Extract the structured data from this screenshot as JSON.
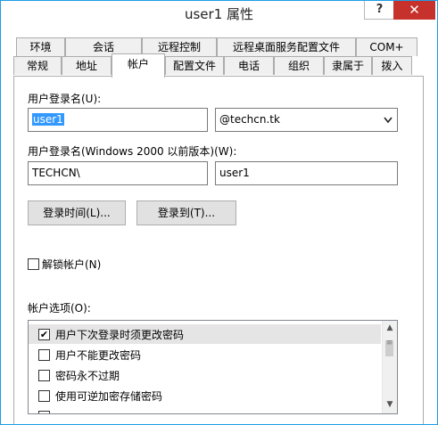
{
  "window": {
    "title": "user1 属性",
    "help_glyph": "?",
    "close_glyph": "✕"
  },
  "tabs_row1": [
    "环境",
    "会话",
    "远程控制",
    "远程桌面服务配置文件",
    "COM+"
  ],
  "tabs_row2": [
    "常规",
    "地址",
    "帐户",
    "配置文件",
    "电话",
    "组织",
    "隶属于",
    "拨入"
  ],
  "active_tab": "帐户",
  "account": {
    "logon_name_label": "用户登录名(U):",
    "logon_name_value": "user1",
    "domain_suffix": "@techcn.tk",
    "pre2000_label": "用户登录名(Windows 2000 以前版本)(W):",
    "pre2000_domain": "TECHCN\\",
    "pre2000_user": "user1",
    "logon_hours_button": "登录时间(L)...",
    "logon_to_button": "登录到(T)...",
    "unlock_label": "解锁帐户(N)",
    "unlock_checked": false,
    "options_label": "帐户选项(O):",
    "options": [
      {
        "label": "用户下次登录时须更改密码",
        "checked": true
      },
      {
        "label": "用户不能更改密码",
        "checked": false
      },
      {
        "label": "密码永不过期",
        "checked": false
      },
      {
        "label": "使用可逆加密存储密码",
        "checked": false
      },
      {
        "label": "",
        "checked": false
      }
    ]
  },
  "icons": {
    "dropdown": "chevron-down-icon",
    "check": "✔",
    "scroll_up": "▲",
    "scroll_down": "▼"
  }
}
